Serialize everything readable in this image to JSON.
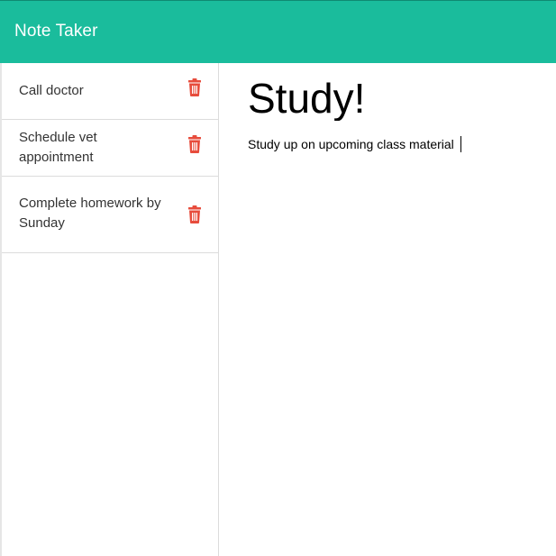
{
  "app": {
    "brand": "Note Taker"
  },
  "colors": {
    "navbar": "#1abc9c",
    "trash": "#e74c3c"
  },
  "sidebar": {
    "notes": [
      {
        "title": "Call doctor",
        "icon": "trash-icon"
      },
      {
        "title": "Schedule vet appointment",
        "icon": "trash-icon"
      },
      {
        "title": "Complete homework by Sunday",
        "icon": "trash-icon"
      }
    ]
  },
  "editor": {
    "title": "Study!",
    "text": "Study up on upcoming class material"
  }
}
